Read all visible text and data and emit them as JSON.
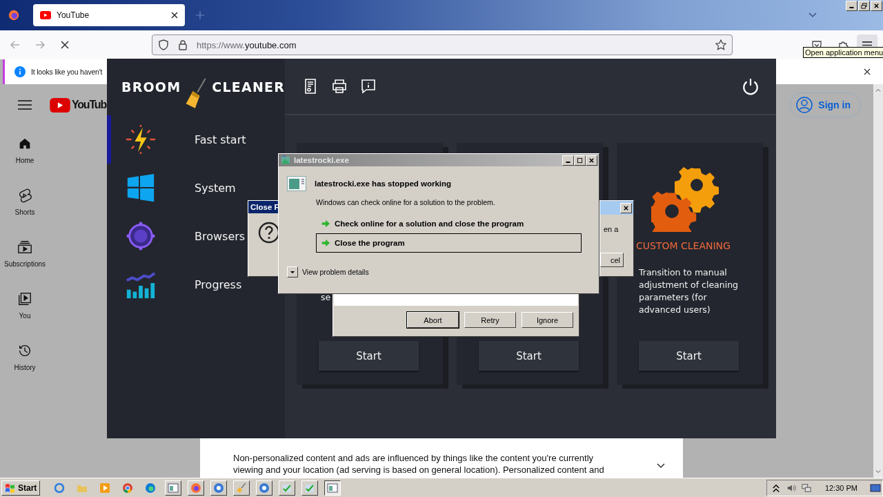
{
  "browser": {
    "tab": {
      "title": "YouTube"
    },
    "url_prefix": "https://www.",
    "url_host": "youtube.com",
    "tooltip": "Open application menu",
    "notification": "It looks like you haven't"
  },
  "youtube": {
    "logo": "YouTub",
    "sign_in": "Sign in",
    "nav": [
      {
        "label": "Home",
        "kind": "home"
      },
      {
        "label": "Shorts",
        "kind": "shorts"
      },
      {
        "label": "Subscriptions",
        "kind": "subscriptions"
      },
      {
        "label": "You",
        "kind": "you"
      },
      {
        "label": "History",
        "kind": "history"
      }
    ],
    "consent": [
      "Non-personalized content and ads are influenced by things like the content you're currently",
      "viewing and your location (ad serving is based on general location). Personalized content and"
    ]
  },
  "app": {
    "logo": [
      "BROOM",
      "CLEANER"
    ],
    "nav": [
      {
        "label": "Fast start",
        "kind": "bolt",
        "selected": true
      },
      {
        "label": "System",
        "kind": "windows",
        "selected": false
      },
      {
        "label": "Browsers",
        "kind": "com",
        "selected": false
      },
      {
        "label": "Progress",
        "kind": "chart",
        "selected": false
      }
    ],
    "cards": [
      {
        "description": "se",
        "button": "Start"
      },
      {
        "button": "Start"
      },
      {
        "kind": "gears",
        "title": "CUSTOM CLEANING",
        "description": "Transition to manual adjustment of cleaning parameters (for advanced users)",
        "button": "Start"
      }
    ]
  },
  "close_dialog": {
    "title": "Close F"
  },
  "side_dialog": {
    "text": "en a",
    "button": "cel"
  },
  "retry_dialog": {
    "buttons": [
      "Abort",
      "Retry",
      "Ignore"
    ]
  },
  "error_dialog": {
    "title": "latestrocki.exe",
    "heading": "latestrocki.exe has stopped working",
    "text": "Windows can check online for a solution to the problem.",
    "options": [
      {
        "label": "Check online for a solution and close the program",
        "selected": false
      },
      {
        "label": "Close the program",
        "selected": true
      }
    ],
    "details": "View problem details"
  },
  "taskbar": {
    "start": "Start",
    "clock": "12:30 PM"
  }
}
